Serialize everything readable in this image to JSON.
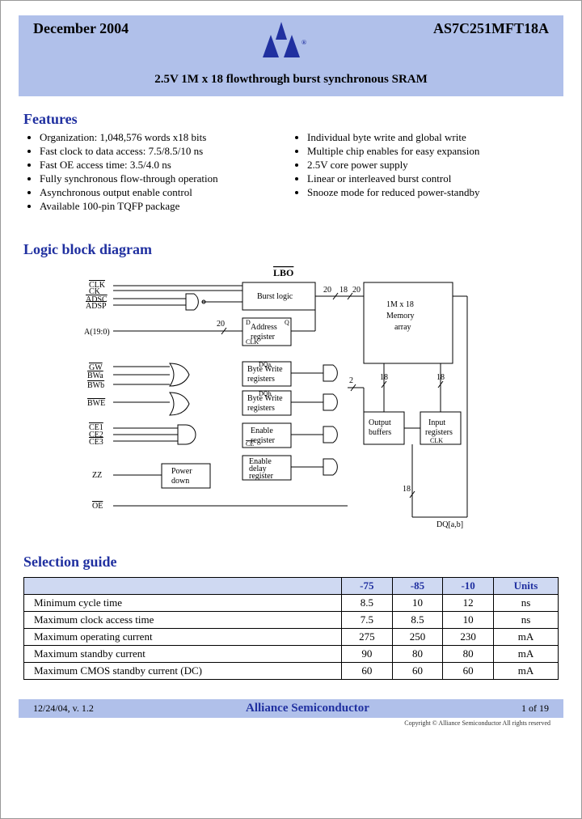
{
  "header": {
    "date": "December 2004",
    "part": "AS7C251MFT18A",
    "subtitle": "2.5V 1M x 18 flowthrough burst synchronous SRAM"
  },
  "features": {
    "title": "Features",
    "col1": [
      "Organization: 1,048,576 words x18 bits",
      "Fast clock to data access: 7.5/8.5/10 ns",
      "Fast OE access time: 3.5/4.0 ns",
      "Fully synchronous flow-through operation",
      "Asynchronous output enable control",
      "Available 100-pin TQFP package"
    ],
    "col2": [
      "Individual byte write and global write",
      "Multiple chip enables for easy expansion",
      "2.5V core power supply",
      "Linear or interleaved burst control",
      "Snooze mode for reduced power-standby"
    ]
  },
  "diagram": {
    "title": "Logic block diagram",
    "lbo": "LBO",
    "burst": "Burst logic",
    "mem1": "1M x 18",
    "mem2": "Memory",
    "mem3": "array",
    "addr1": "Address",
    "addr2": "register",
    "bw1": "Byte Write",
    "bw2": "registers",
    "en1": "Enable",
    "en2": "register",
    "od1": "Enable",
    "od2": "delay",
    "od3": "register",
    "out1": "Output",
    "out2": "buffers",
    "in1": "Input",
    "in2": "registers",
    "pd1": "Power",
    "pd2": "down",
    "n20": "20",
    "n18": "18",
    "n2": "2",
    "dq": "DQ[a,b]",
    "sig_clk": "CLK",
    "sig_ck": "CK",
    "sig_adsc": "ADSC",
    "sig_adsp": "ADSP",
    "sig_a": "A(19:0)",
    "sig_gw": "GW",
    "sig_bwa": "BWa",
    "sig_bwb": "BWb",
    "sig_bwe": "BWE",
    "sig_ce1": "CE1",
    "sig_ce2": "CE2",
    "sig_ce3": "CE3",
    "sig_zz": "ZZ",
    "sig_oe": "OE",
    "sig_ce": "CE",
    "sig_d": "D",
    "sig_q": "Q",
    "sig_dqa": "DQa",
    "sig_dqb": "DQb"
  },
  "selection": {
    "title": "Selection guide",
    "headers": [
      "",
      "-75",
      "-85",
      "-10",
      "Units"
    ],
    "rows": [
      {
        "label": "Minimum cycle time",
        "v": [
          "8.5",
          "10",
          "12"
        ],
        "u": "ns"
      },
      {
        "label": "Maximum clock access time",
        "v": [
          "7.5",
          "8.5",
          "10"
        ],
        "u": "ns"
      },
      {
        "label": "Maximum operating current",
        "v": [
          "275",
          "250",
          "230"
        ],
        "u": "mA"
      },
      {
        "label": "Maximum standby current",
        "v": [
          "90",
          "80",
          "80"
        ],
        "u": "mA"
      },
      {
        "label": "Maximum CMOS standby current (DC)",
        "v": [
          "60",
          "60",
          "60"
        ],
        "u": "mA"
      }
    ]
  },
  "footer": {
    "left": "12/24/04, v. 1.2",
    "mid": "Alliance Semiconductor",
    "right": "1 of 19",
    "copy": "Copyright © Alliance Semiconductor All rights reserved"
  }
}
